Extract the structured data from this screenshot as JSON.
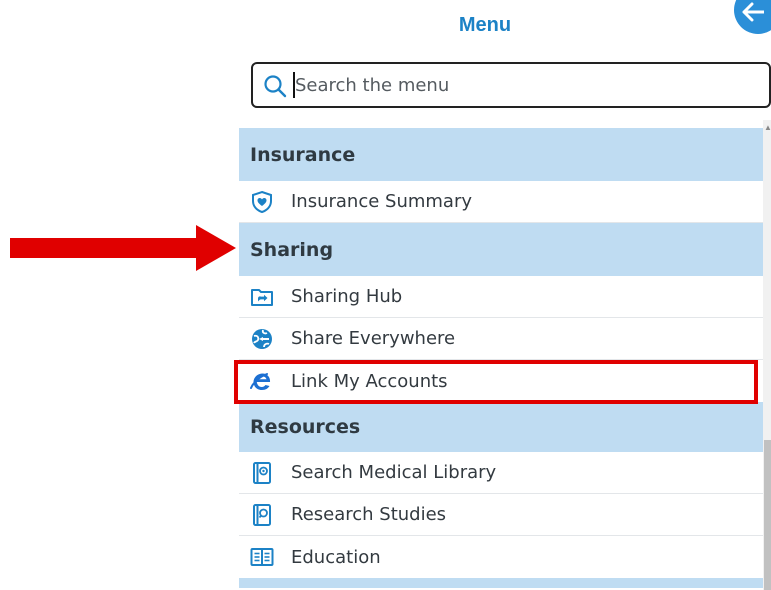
{
  "header": {
    "title": "Menu"
  },
  "search": {
    "placeholder": "Search the menu"
  },
  "sections": {
    "insurance": {
      "label": "Insurance",
      "items": [
        "Insurance Summary"
      ]
    },
    "sharing": {
      "label": "Sharing",
      "items": [
        "Sharing Hub",
        "Share Everywhere",
        "Link My Accounts"
      ]
    },
    "resources": {
      "label": "Resources",
      "items": [
        "Search Medical Library",
        "Research Studies",
        "Education"
      ]
    }
  },
  "colors": {
    "accent": "#1c82c6",
    "section_bg": "#bfdcf2",
    "annotation": "#e00000"
  }
}
